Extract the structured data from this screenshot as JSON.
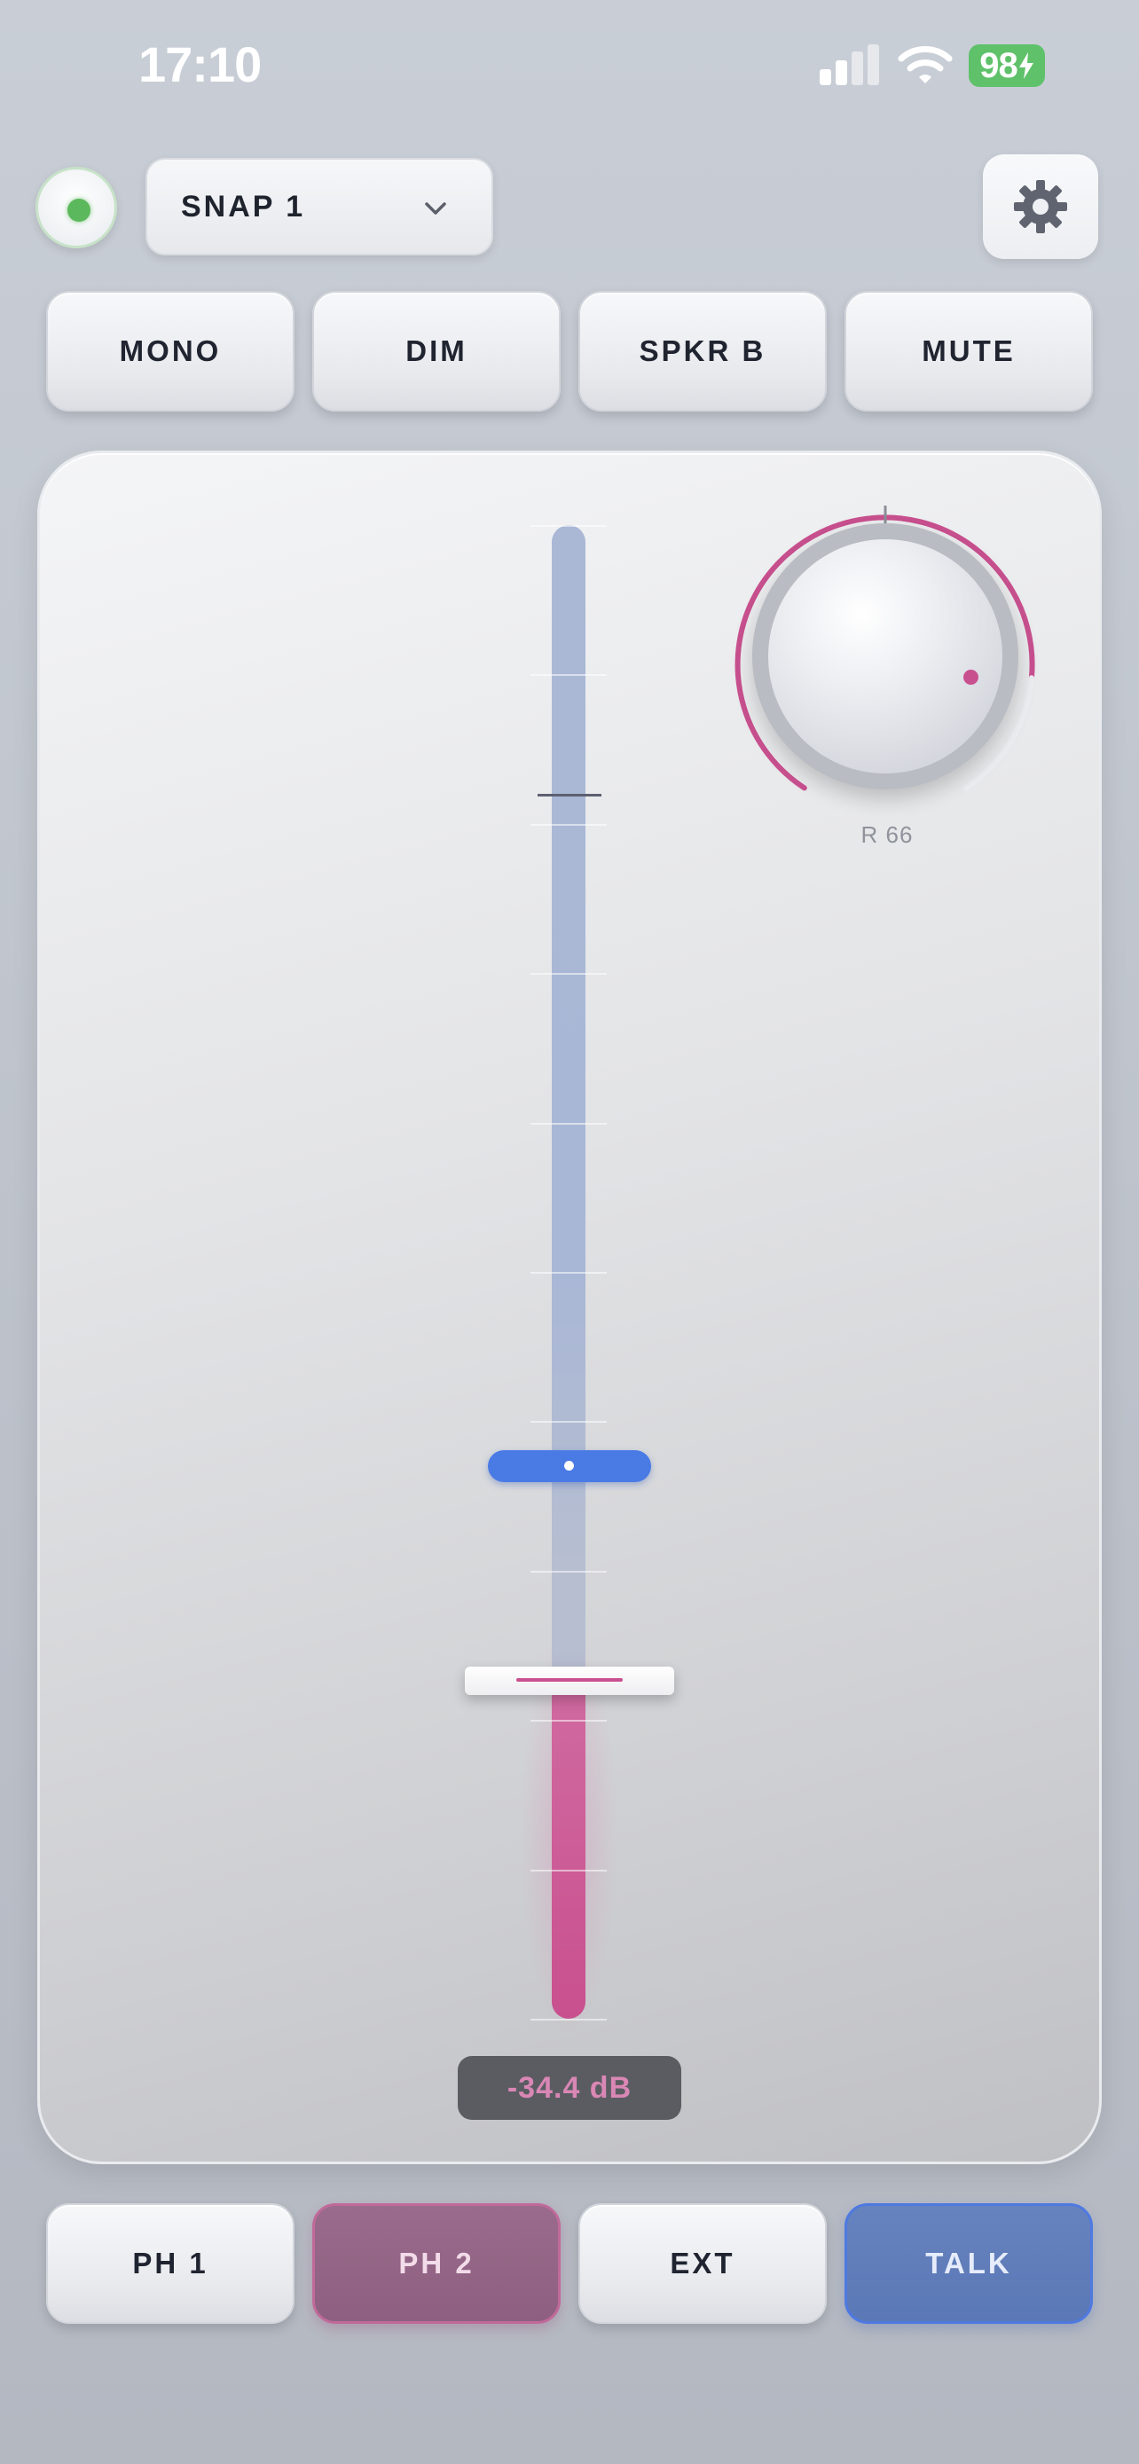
{
  "status_bar": {
    "time": "17:10",
    "battery": "98"
  },
  "header": {
    "snapshot_label": "SNAP 1",
    "power_led_color": "#5cb85c"
  },
  "top_buttons": [
    {
      "label": "MONO"
    },
    {
      "label": "DIM"
    },
    {
      "label": "SPKR B"
    },
    {
      "label": "MUTE"
    }
  ],
  "monitor": {
    "level_readout": "-34.4 dB",
    "fader_fill_fraction": 0.225,
    "blue_marker_fraction": 0.37,
    "knob_label": "R 66",
    "knob_arc_fraction": 0.6,
    "accent_color": "#c9508f",
    "talk_color": "#4a7be5"
  },
  "bottom_buttons": [
    {
      "label": "PH 1",
      "state": "off"
    },
    {
      "label": "PH 2",
      "state": "active"
    },
    {
      "label": "EXT",
      "state": "off"
    },
    {
      "label": "TALK",
      "state": "active"
    }
  ],
  "icons": {
    "settings": "gear-icon",
    "dropdown": "chevron-down-icon",
    "signal": "cellular-signal-icon",
    "wifi": "wifi-icon",
    "battery": "battery-charging-icon"
  }
}
